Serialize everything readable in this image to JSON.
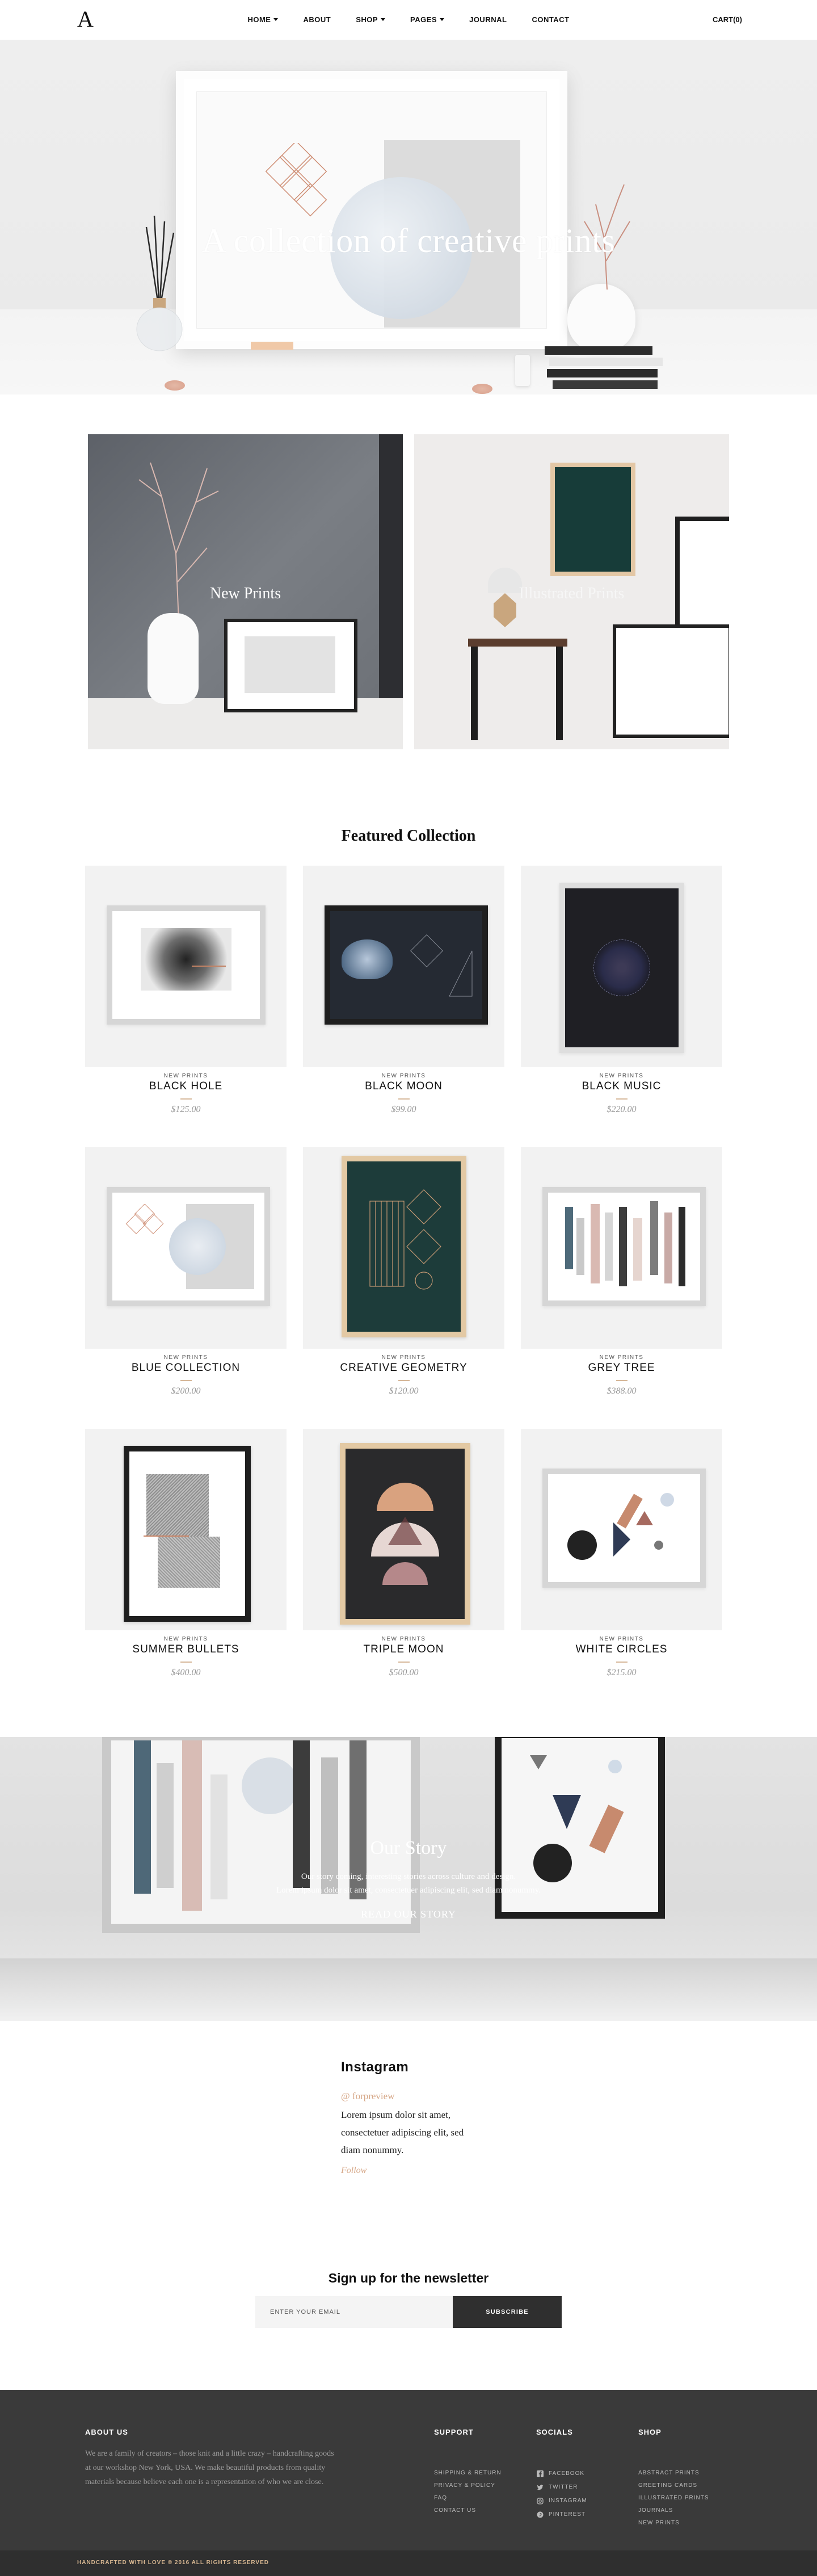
{
  "header": {
    "logo": "A",
    "nav": [
      {
        "label": "HOME",
        "dropdown": true
      },
      {
        "label": "ABOUT",
        "dropdown": false
      },
      {
        "label": "SHOP",
        "dropdown": true
      },
      {
        "label": "PAGES",
        "dropdown": true
      },
      {
        "label": "JOURNAL",
        "dropdown": false
      },
      {
        "label": "CONTACT",
        "dropdown": false
      }
    ],
    "cart": "CART(0)"
  },
  "hero": {
    "title": "A collection of creative prints"
  },
  "categories": [
    {
      "label": "New Prints"
    },
    {
      "label": "Illustrated Prints"
    }
  ],
  "featured": {
    "title": "Featured Collection",
    "products": [
      {
        "category": "NEW PRINTS",
        "name": "BLACK HOLE",
        "price": "$125.00"
      },
      {
        "category": "NEW PRINTS",
        "name": "BLACK MOON",
        "price": "$99.00"
      },
      {
        "category": "NEW PRINTS",
        "name": "BLACK MUSIC",
        "price": "$220.00"
      },
      {
        "category": "NEW PRINTS",
        "name": "BLUE COLLECTION",
        "price": "$200.00"
      },
      {
        "category": "NEW PRINTS",
        "name": "CREATIVE GEOMETRY",
        "price": "$120.00"
      },
      {
        "category": "NEW PRINTS",
        "name": "GREY TREE",
        "price": "$388.00"
      },
      {
        "category": "NEW PRINTS",
        "name": "SUMMER BULLETS",
        "price": "$400.00"
      },
      {
        "category": "NEW PRINTS",
        "name": "TRIPLE MOON",
        "price": "$500.00"
      },
      {
        "category": "NEW PRINTS",
        "name": "WHITE CIRCLES",
        "price": "$215.00"
      }
    ]
  },
  "story": {
    "title": "Our Story",
    "line1": "Our story coming, interesting stories across culture and design.",
    "line2": "Lorem ipsum dolor sit amet, consectetuer adipiscing elit, sed diam nonummy.",
    "link": "READ OUR STORY"
  },
  "instagram": {
    "title": "Instagram",
    "handle": "@ forpreview",
    "body": "Lorem ipsum dolor sit amet, consectetuer adipiscing elit, sed diam nonummy.",
    "follow": "Follow"
  },
  "newsletter": {
    "title": "Sign up for the newsletter",
    "placeholder": "ENTER YOUR EMAIL",
    "button": "SUBSCRIBE"
  },
  "footer": {
    "about_title": "ABOUT US",
    "about_text": "We are a family of creators – those knit and a little crazy – handcrafting goods at our workshop New York, USA. We make beautiful products from quality materials because believe each one is a representation of who we are close.",
    "support_title": "SUPPORT",
    "support": [
      "SHIPPING & RETURN",
      "PRIVACY & POLICY",
      "FAQ",
      "CONTACT US"
    ],
    "socials_title": "SOCIALS",
    "socials": [
      "FACEBOOK",
      "TWITTER",
      "INSTAGRAM",
      "PINTEREST"
    ],
    "shop_title": "SHOP",
    "shop": [
      "ABSTRACT PRINTS",
      "GREETING CARDS",
      "ILLUSTRATED PRINTS",
      "JOURNALS",
      "NEW PRINTS"
    ],
    "copyright": "HANDCRAFTED WITH LOVE © 2016 ALL RIGHTS RESERVED"
  },
  "colors": {
    "accent": "#d7a98a",
    "footer_bg": "#3a3a3a",
    "button_bg": "#2f2f2f"
  }
}
